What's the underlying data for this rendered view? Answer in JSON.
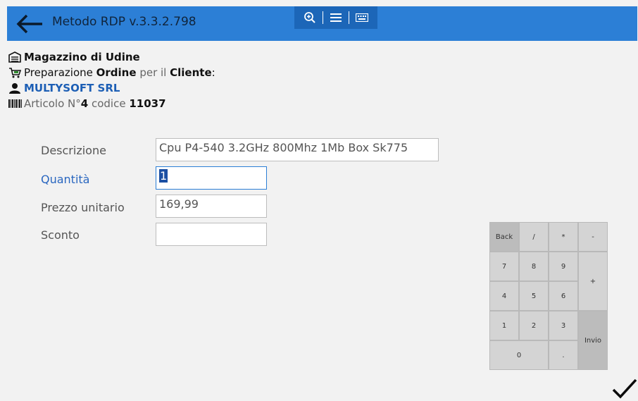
{
  "header": {
    "title": "Metodo RDP v.3.3.2.798",
    "colors": {
      "bar": "#2c7fd6",
      "toolstrip": "#1c66b8"
    },
    "tools": [
      "zoom-in-icon",
      "menu-icon",
      "keyboard-icon"
    ]
  },
  "info": {
    "warehouse": "Magazzino di Udine",
    "prep_prefix": "Preparazione",
    "prep_order": "Ordine",
    "prep_mid": "per il",
    "prep_client": "Cliente",
    "prep_colon": ":",
    "customer": "MULTYSOFT SRL",
    "article_prefix": "Articolo N°",
    "article_number": "4",
    "article_code_label": "codice",
    "article_code": "11037"
  },
  "form": {
    "descrizione_label": "Descrizione",
    "descrizione_value": "Cpu P4-540 3.2GHz 800Mhz 1Mb Box Sk775",
    "quantita_label": "Quantità",
    "quantita_value": "1",
    "prezzo_label": "Prezzo unitario",
    "prezzo_value": "169,99",
    "sconto_label": "Sconto",
    "sconto_value": ""
  },
  "keypad": {
    "back": "Back",
    "slash": "/",
    "star": "*",
    "minus": "-",
    "k7": "7",
    "k8": "8",
    "k9": "9",
    "plus": "+",
    "k4": "4",
    "k5": "5",
    "k6": "6",
    "k1": "1",
    "k2": "2",
    "k3": "3",
    "enter": "Invio",
    "k0": "0",
    "dot": "."
  }
}
